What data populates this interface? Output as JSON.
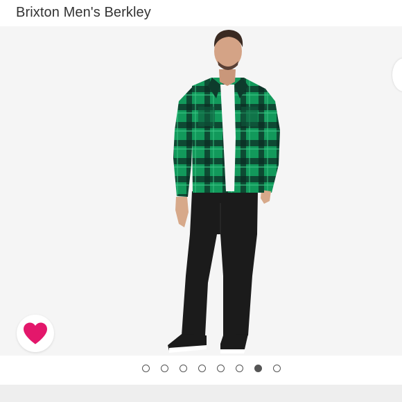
{
  "product": {
    "title": "Brixton Men's Berkley"
  },
  "carousel": {
    "image_count": 8,
    "active_index": 6
  },
  "wishlist": {
    "icon": "heart-icon",
    "color": "#e3176b"
  },
  "colors": {
    "shirt_green": "#139a5d",
    "shirt_dark": "#0d2a25",
    "pants": "#1c1c1c",
    "background": "#f5f5f5"
  }
}
